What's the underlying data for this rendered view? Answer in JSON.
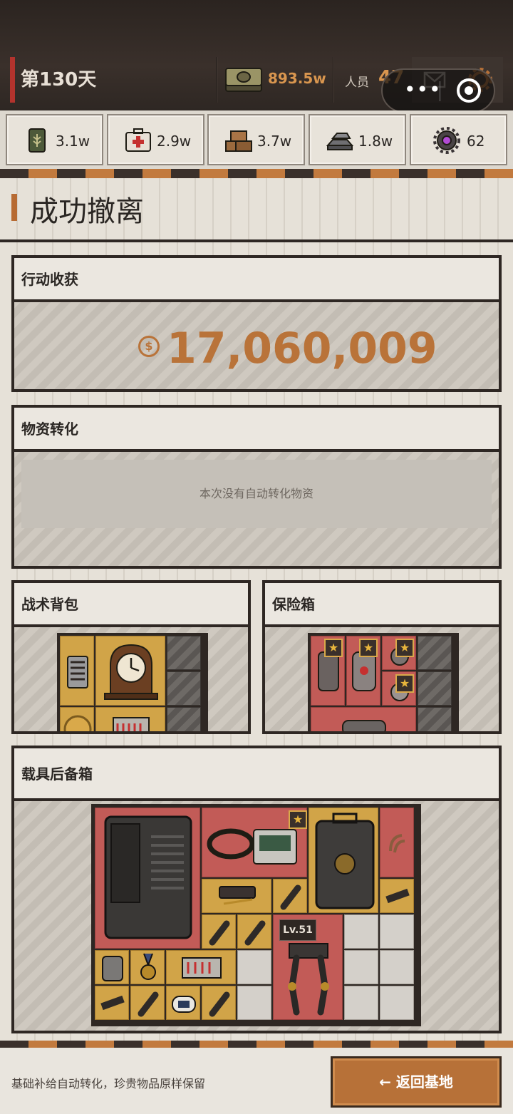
{
  "topbar": {
    "day": "第130天",
    "cash_value": "893.5w",
    "staff_label": "人员",
    "staff_value": "47",
    "capsule_more": "•••"
  },
  "resources": [
    {
      "icon": "food-can-icon",
      "value": "3.1w"
    },
    {
      "icon": "medkit-icon",
      "value": "2.9w"
    },
    {
      "icon": "wood-planks-icon",
      "value": "3.7w"
    },
    {
      "icon": "metal-ingots-icon",
      "value": "1.8w"
    },
    {
      "icon": "gear-core-icon",
      "value": "62"
    }
  ],
  "page": {
    "title": "成功撤离"
  },
  "earnings": {
    "header": "行动收获",
    "currency_symbol": "$",
    "amount": "17,060,009"
  },
  "conversion": {
    "header": "物资转化",
    "empty_text": "本次没有自动转化物资"
  },
  "backpack": {
    "header": "战术背包"
  },
  "safebox": {
    "header": "保险箱"
  },
  "trunk": {
    "header": "载具后备箱",
    "level_badge": "Lv.51"
  },
  "footer": {
    "note": "基础补给自动转化，珍贵物品原样保留",
    "back_button": "← 返回基地"
  },
  "colors": {
    "accent": "#b97339",
    "rare_red": "#c25b57",
    "common_yellow": "#d1a448",
    "dark": "#2e2723"
  }
}
